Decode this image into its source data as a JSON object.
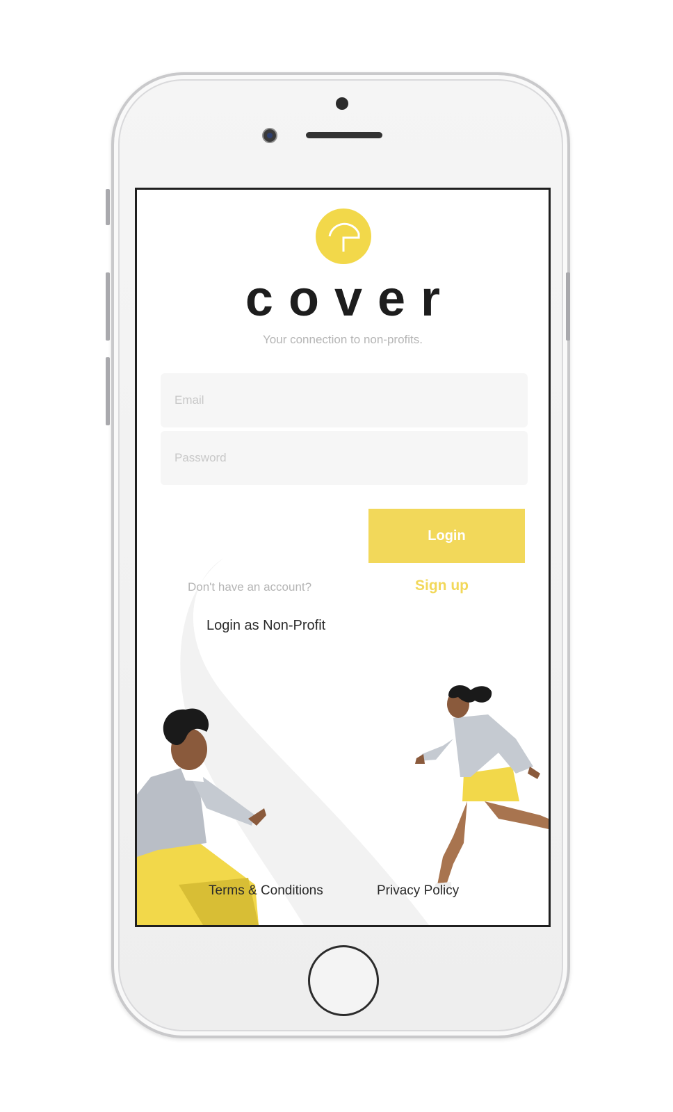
{
  "app": {
    "wordmark": "cover",
    "tagline": "Your connection to non-profits."
  },
  "form": {
    "email_placeholder": "Email",
    "email_value": "",
    "password_placeholder": "Password",
    "password_value": "",
    "login_label": "Login"
  },
  "links": {
    "no_account_text": "Don't have an account?",
    "signup_label": "Sign up",
    "nonprofit_label": "Login as Non-Profit",
    "terms_label": "Terms & Conditions",
    "privacy_label": "Privacy Policy"
  },
  "colors": {
    "brand_yellow": "#f2d84a",
    "text_dark": "#1d1d1d",
    "muted_text": "#b5b5b5",
    "field_bg": "#f6f6f6"
  },
  "icons": {
    "logo": "cover-logo-icon",
    "illustration": "people-meeting-illustration"
  }
}
